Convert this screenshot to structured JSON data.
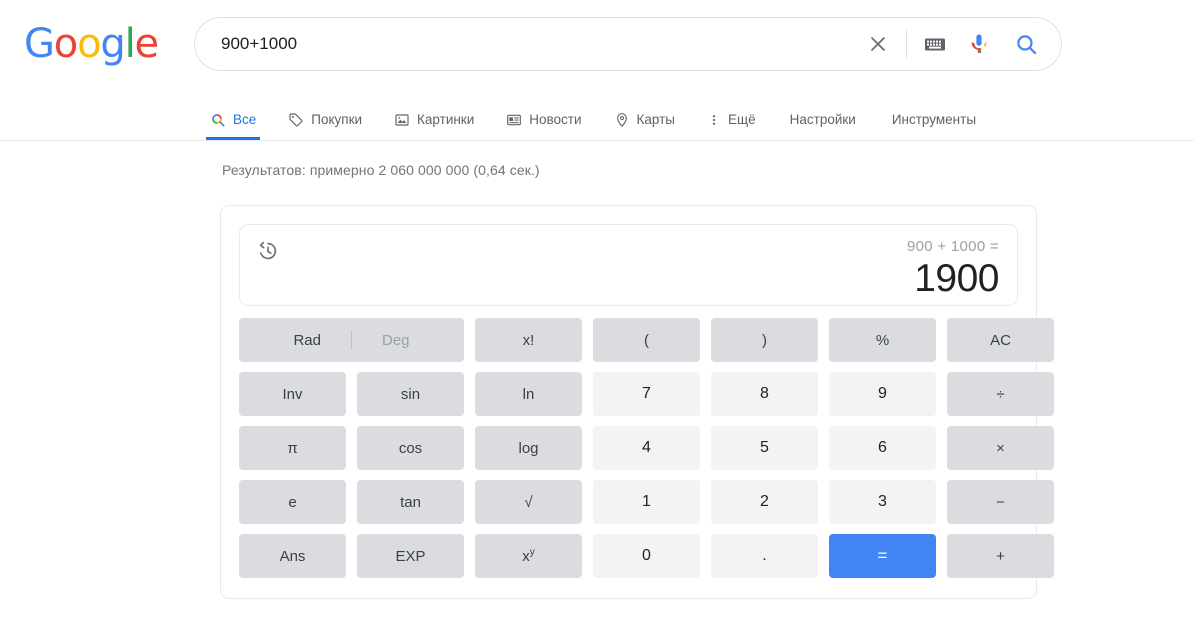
{
  "brand": {
    "logo_letters": [
      {
        "char": "G",
        "color": "#4285f4"
      },
      {
        "char": "o",
        "color": "#ea4335"
      },
      {
        "char": "o",
        "color": "#fbbc05"
      },
      {
        "char": "g",
        "color": "#4285f4"
      },
      {
        "char": "l",
        "color": "#34a853"
      },
      {
        "char": "e",
        "color": "#ea4335"
      }
    ]
  },
  "search": {
    "query": "900+1000",
    "placeholder": "",
    "clear_icon": "close-icon",
    "keyboard_icon": "keyboard-icon",
    "mic_icon": "microphone-icon",
    "search_icon": "search-icon"
  },
  "nav": {
    "tabs": [
      {
        "label": "Все",
        "icon": "search-icon",
        "active": true
      },
      {
        "label": "Покупки",
        "icon": "tag-icon",
        "active": false
      },
      {
        "label": "Картинки",
        "icon": "image-icon",
        "active": false
      },
      {
        "label": "Новости",
        "icon": "news-icon",
        "active": false
      },
      {
        "label": "Карты",
        "icon": "map-pin-icon",
        "active": false
      },
      {
        "label": "Ещё",
        "icon": "more-vertical-icon",
        "active": false
      }
    ],
    "settings_label": "Настройки",
    "tools_label": "Инструменты"
  },
  "results": {
    "stats": "Результатов: примерно 2 060 000 000 (0,64 сек.)"
  },
  "calculator": {
    "history_icon": "history-icon",
    "expression": "900 + 1000 =",
    "result": "1900",
    "mode": {
      "rad_label": "Rad",
      "deg_label": "Deg",
      "active": "Rad"
    },
    "rows": [
      [
        {
          "label": "x!",
          "type": "fn"
        },
        {
          "label": "(",
          "type": "fn"
        },
        {
          "label": ")",
          "type": "fn"
        },
        {
          "label": "%",
          "type": "fn"
        },
        {
          "label": "AC",
          "type": "fn"
        }
      ],
      [
        {
          "label": "Inv",
          "type": "fn"
        },
        {
          "label": "sin",
          "type": "fn"
        },
        {
          "label": "ln",
          "type": "fn"
        },
        {
          "label": "7",
          "type": "num"
        },
        {
          "label": "8",
          "type": "num"
        },
        {
          "label": "9",
          "type": "num"
        },
        {
          "label": "÷",
          "type": "fn"
        }
      ],
      [
        {
          "label": "π",
          "type": "fn"
        },
        {
          "label": "cos",
          "type": "fn"
        },
        {
          "label": "log",
          "type": "fn"
        },
        {
          "label": "4",
          "type": "num"
        },
        {
          "label": "5",
          "type": "num"
        },
        {
          "label": "6",
          "type": "num"
        },
        {
          "label": "×",
          "type": "fn"
        }
      ],
      [
        {
          "label": "e",
          "type": "fn"
        },
        {
          "label": "tan",
          "type": "fn"
        },
        {
          "label": "√",
          "type": "fn"
        },
        {
          "label": "1",
          "type": "num"
        },
        {
          "label": "2",
          "type": "num"
        },
        {
          "label": "3",
          "type": "num"
        },
        {
          "label": "−",
          "type": "fn"
        }
      ],
      [
        {
          "label": "Ans",
          "type": "fn"
        },
        {
          "label": "EXP",
          "type": "fn"
        },
        {
          "label": "xy",
          "type": "pow"
        },
        {
          "label": "0",
          "type": "num"
        },
        {
          "label": ".",
          "type": "num"
        },
        {
          "label": "=",
          "type": "equals"
        },
        {
          "label": "+",
          "type": "fn"
        }
      ]
    ]
  },
  "colors": {
    "google_blue": "#4285f4",
    "link_blue": "#1a73e8",
    "key_fn": "#dadce0",
    "key_num": "#f1f3f4",
    "text_dark": "#202124",
    "text_muted": "#70757a"
  }
}
